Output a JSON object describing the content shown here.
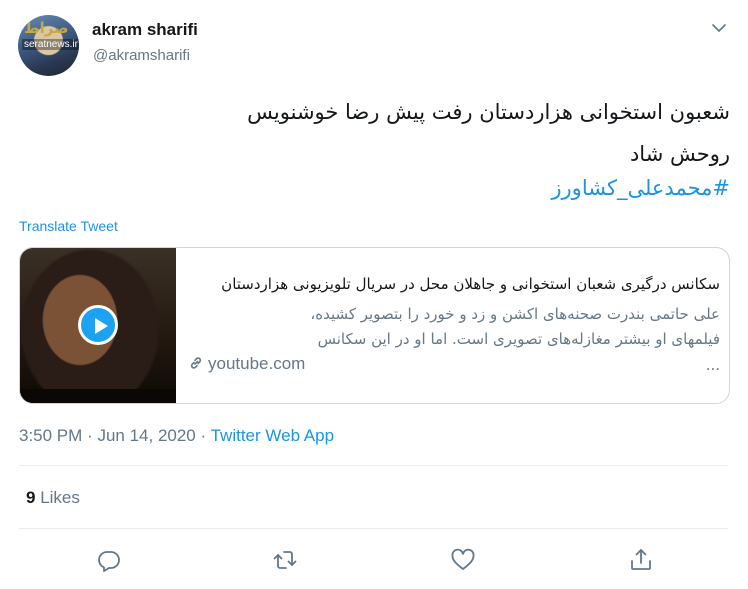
{
  "user": {
    "name": "akram sharifi",
    "handle": "@akramsharifi",
    "avatar_watermark": "صراط",
    "avatar_site": "seratnews.ir"
  },
  "tweet": {
    "line1": "شعبون استخوانی هزاردستان رفت پیش رضا خوشنویس",
    "line2": "روحش شاد",
    "hashtag": "#محمدعلی_کشاورز",
    "translate_label": "Translate Tweet"
  },
  "card": {
    "title": "سکانس درگیری شعبان استخوانی و جاهلان محل در سریال تلویزیونی هزاردستان",
    "description_lines": [
      "علی حاتمی بندرت صحنه‌های اکشن و زد و خورد را بتصویر کشیده،",
      "فیلمهای او بیشتر مغازله‌های تصویری است. اما او در این سکانس",
      "..."
    ],
    "domain": "youtube.com",
    "play_icon": "play-icon",
    "link_icon": "link-icon"
  },
  "meta": {
    "time": "3:50 PM",
    "separator": "·",
    "date": "Jun 14, 2020",
    "source": "Twitter Web App"
  },
  "engagement": {
    "likes_count": "9",
    "likes_label": "Likes"
  },
  "actions": {
    "reply_icon": "reply-icon",
    "retweet_icon": "retweet-icon",
    "like_icon": "heart-icon",
    "share_icon": "share-icon"
  },
  "colors": {
    "link": "#1b95e0",
    "secondary_text": "#657786",
    "border": "#ccd6dd",
    "play_button": "#1da1f2"
  }
}
